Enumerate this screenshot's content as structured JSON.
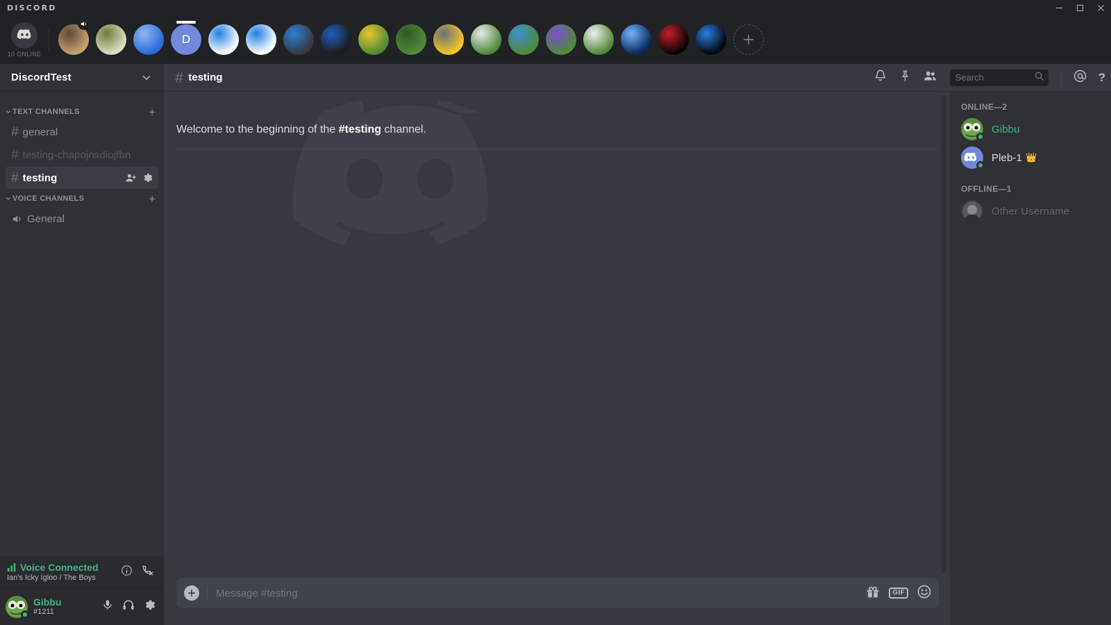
{
  "window": {
    "brand": "DISCORD",
    "controls": [
      {
        "name": "minimize",
        "glyph": "—"
      },
      {
        "name": "maximize",
        "glyph": "□"
      },
      {
        "name": "close",
        "glyph": "✕"
      }
    ]
  },
  "server_bar": {
    "home_icon": "discord-logo-icon",
    "online_count": "10 ONLINE",
    "add_server_label": "+",
    "guilds": [
      {
        "name": "dog-server",
        "letter": "",
        "color1": "#c8a070",
        "color2": "#5b4a36",
        "selected": false,
        "voice_badge": true
      },
      {
        "name": "cross-server",
        "letter": "",
        "color1": "#d8dfc0",
        "color2": "#6d7a3a",
        "selected": false,
        "voice_badge": false
      },
      {
        "name": "anime-server",
        "letter": "",
        "color1": "#2b6bd8",
        "color2": "#8fb8f0",
        "selected": false,
        "voice_badge": false
      },
      {
        "name": "discordtest-server",
        "letter": "D",
        "color1": "#7289da",
        "color2": "#7289da",
        "selected": true,
        "voice_badge": false
      },
      {
        "name": "b-white-server",
        "letter": "",
        "color1": "#ffffff",
        "color2": "#1f7fe0",
        "selected": false,
        "voice_badge": false
      },
      {
        "name": "b2-white-server",
        "letter": "",
        "color1": "#ffffff",
        "color2": "#1f7fe0",
        "selected": false,
        "voice_badge": false
      },
      {
        "name": "b-dark-server",
        "letter": "",
        "color1": "#36393f",
        "color2": "#2b7fd4",
        "selected": false,
        "voice_badge": false
      },
      {
        "name": "d-dark-server",
        "letter": "",
        "color1": "#1b1c20",
        "color2": "#1f5fc0",
        "selected": false,
        "voice_badge": false
      },
      {
        "name": "pepe-king-server",
        "letter": "",
        "color1": "#4f8a3a",
        "color2": "#e8c42a",
        "selected": false,
        "voice_badge": false
      },
      {
        "name": "pepe-a-server",
        "letter": "",
        "color1": "#4f8a3a",
        "color2": "#2f5a22",
        "selected": false,
        "voice_badge": false
      },
      {
        "name": "emoji-hat-server",
        "letter": "",
        "color1": "#f2c32b",
        "color2": "#6b7178",
        "selected": false,
        "voice_badge": false
      },
      {
        "name": "pepe-abc-server",
        "letter": "",
        "color1": "#4f8a3a",
        "color2": "#e8e8e8",
        "selected": false,
        "voice_badge": false
      },
      {
        "name": "pepe-book-server",
        "letter": "",
        "color1": "#4f8a3a",
        "color2": "#3d8fd0",
        "selected": false,
        "voice_badge": false
      },
      {
        "name": "pepe-phone-server",
        "letter": "",
        "color1": "#4f8a3a",
        "color2": "#7a4fd0",
        "selected": false,
        "voice_badge": false
      },
      {
        "name": "pepe-coffee-server",
        "letter": "",
        "color1": "#4f8a3a",
        "color2": "#efefef",
        "selected": false,
        "voice_badge": false
      },
      {
        "name": "breach-server",
        "letter": "",
        "color1": "#0b2a5a",
        "color2": "#6fb4ff",
        "selected": false,
        "voice_badge": false
      },
      {
        "name": "red-eye-server",
        "letter": "",
        "color1": "#0a0406",
        "color2": "#c0202a",
        "selected": false,
        "voice_badge": false
      },
      {
        "name": "esa-blue-server",
        "letter": "",
        "color1": "#040810",
        "color2": "#2a7fe0",
        "selected": false,
        "voice_badge": false
      }
    ]
  },
  "sidebar": {
    "guild_name": "DiscordTest",
    "categories": [
      {
        "name": "TEXT CHANNELS",
        "type": "text",
        "channels": [
          {
            "name": "general",
            "state": "read",
            "active": false
          },
          {
            "name": "testing-chapojnsdiojfbn",
            "state": "muted",
            "active": false
          },
          {
            "name": "testing",
            "state": "active",
            "active": true
          }
        ]
      },
      {
        "name": "VOICE CHANNELS",
        "type": "voice",
        "channels": [
          {
            "name": "General",
            "state": "read",
            "active": false
          }
        ]
      }
    ],
    "voice_panel": {
      "status": "Voice Connected",
      "location": "Ian's Icky Igloo / The Boys",
      "status_color": "#43b581"
    },
    "user_panel": {
      "username": "Gibbu",
      "tag": "#1211",
      "status_color": "#43b581"
    }
  },
  "channel_header": {
    "hash": "#",
    "name": "testing",
    "search_placeholder": "Search"
  },
  "main": {
    "welcome_prefix": "Welcome to the beginning of the ",
    "welcome_channel": "#testing",
    "welcome_suffix": " channel."
  },
  "composer": {
    "placeholder": "Message #testing",
    "gif_label": "GIF"
  },
  "members": {
    "groups": [
      {
        "label": "ONLINE—2",
        "members": [
          {
            "name": "Gibbu",
            "color": "#43b581",
            "status": "online",
            "status_color": "#43b581",
            "badge": "",
            "avatar_kind": "pepe"
          },
          {
            "name": "Pleb-1",
            "color": "#dcddde",
            "status": "online",
            "status_color": "#43b581",
            "badge": "👑",
            "avatar_kind": "discord"
          }
        ]
      },
      {
        "label": "OFFLINE—1",
        "members": [
          {
            "name": "Other Username",
            "color": "#8e9297",
            "status": "offline",
            "status_color": "#747f8d",
            "badge": "",
            "avatar_kind": "gray"
          }
        ]
      }
    ]
  },
  "colors": {
    "accent": "#7289da",
    "online": "#43b581",
    "bg_dark": "#202225",
    "bg_sidebar": "#2f3136",
    "bg_main": "#36393f"
  }
}
